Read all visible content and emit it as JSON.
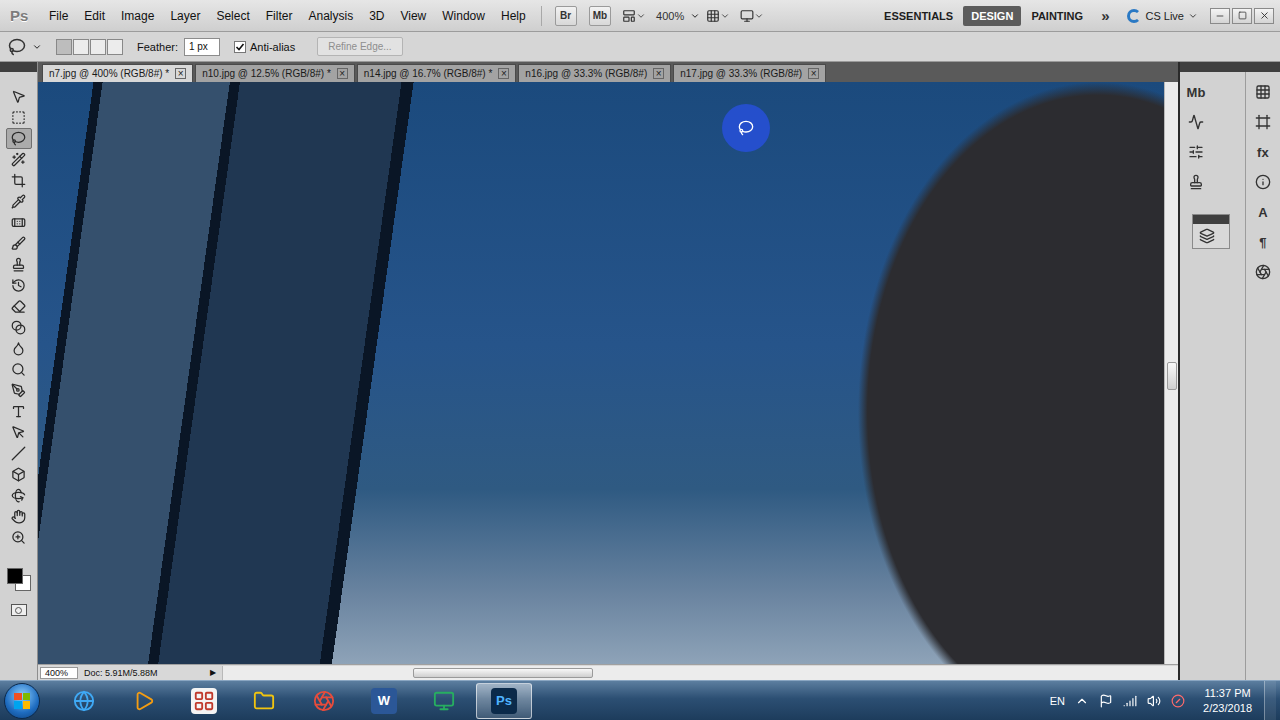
{
  "app": {
    "logo": "Ps"
  },
  "menu": [
    "File",
    "Edit",
    "Image",
    "Layer",
    "Select",
    "Filter",
    "Analysis",
    "3D",
    "View",
    "Window",
    "Help"
  ],
  "app_bar": {
    "bridge": "Br",
    "mini_bridge": "Mb",
    "zoom": "400%"
  },
  "workspaces": [
    {
      "label": "ESSENTIALS",
      "selected": false
    },
    {
      "label": "DESIGN",
      "selected": true
    },
    {
      "label": "PAINTING",
      "selected": false
    }
  ],
  "more_workspaces": "»",
  "cs_live": "CS Live",
  "options_bar": {
    "feather_label": "Feather:",
    "feather_value": "1 px",
    "anti_alias": {
      "label": "Anti-alias",
      "checked": true
    },
    "refine_edge": {
      "label": "Refine Edge...",
      "disabled": true
    }
  },
  "tabs": [
    {
      "label": "n7.jpg @ 400% (RGB/8#) *",
      "selected": true,
      "close": "×"
    },
    {
      "label": "n10.jpg @ 12.5% (RGB/8#) *",
      "selected": false,
      "close": "×"
    },
    {
      "label": "n14.jpg @ 16.7% (RGB/8#) *",
      "selected": false,
      "close": "×"
    },
    {
      "label": "n16.jpg @ 33.3% (RGB/8#)",
      "selected": false,
      "close": "×"
    },
    {
      "label": "n17.jpg @ 33.3% (RGB/8#)",
      "selected": false,
      "close": "×"
    }
  ],
  "tools": [
    {
      "kind": "move",
      "selected": false
    },
    {
      "kind": "marquee",
      "selected": false
    },
    {
      "kind": "lasso",
      "selected": true
    },
    {
      "kind": "quick-selection",
      "selected": false
    },
    {
      "kind": "crop",
      "selected": false
    },
    {
      "kind": "eyedropper",
      "selected": false
    },
    {
      "kind": "healing",
      "selected": false
    },
    {
      "kind": "brush",
      "selected": false
    },
    {
      "kind": "clone-stamp",
      "selected": false
    },
    {
      "kind": "history-brush",
      "selected": false
    },
    {
      "kind": "eraser",
      "selected": false
    },
    {
      "kind": "gradient",
      "selected": false
    },
    {
      "kind": "blur",
      "selected": false
    },
    {
      "kind": "dodge",
      "selected": false
    },
    {
      "kind": "pen",
      "selected": false
    },
    {
      "kind": "type",
      "selected": false
    },
    {
      "kind": "path-selection",
      "selected": false
    },
    {
      "kind": "line",
      "selected": false
    },
    {
      "kind": "3d-rotate",
      "selected": false
    },
    {
      "kind": "3d-orbit",
      "selected": false
    },
    {
      "kind": "hand",
      "selected": false
    },
    {
      "kind": "zoom",
      "selected": false
    }
  ],
  "colors": {
    "foreground": "#000000",
    "background": "#ffffff"
  },
  "status_bar": {
    "zoom": "400%",
    "doc": "Doc: 5.91M/5.88M",
    "arrow": "▶"
  },
  "dock": {
    "column1": [
      {
        "kind": "mini-bridge",
        "label": "Mb"
      },
      {
        "kind": "histogram"
      },
      {
        "kind": "adjustments"
      },
      {
        "kind": "clone-source"
      }
    ],
    "column2": [
      {
        "kind": "grid"
      },
      {
        "kind": "transform"
      },
      {
        "kind": "styles",
        "label": "fx"
      },
      {
        "kind": "info"
      },
      {
        "kind": "character",
        "label": "A"
      },
      {
        "kind": "paragraph",
        "label": "¶"
      },
      {
        "kind": "lens"
      }
    ],
    "group": [
      {
        "kind": "layers"
      }
    ]
  },
  "taskbar": {
    "items": [
      {
        "kind": "ie",
        "selected": false
      },
      {
        "kind": "media",
        "selected": false
      },
      {
        "kind": "app",
        "selected": false
      },
      {
        "kind": "folder",
        "selected": false
      },
      {
        "kind": "chrome",
        "selected": false
      },
      {
        "kind": "word",
        "label": "W",
        "selected": false
      },
      {
        "kind": "vnc",
        "selected": false
      },
      {
        "kind": "photoshop",
        "label": "Ps",
        "selected": true
      }
    ],
    "language": "EN",
    "time": "11:37 PM",
    "date": "2/23/2018"
  }
}
